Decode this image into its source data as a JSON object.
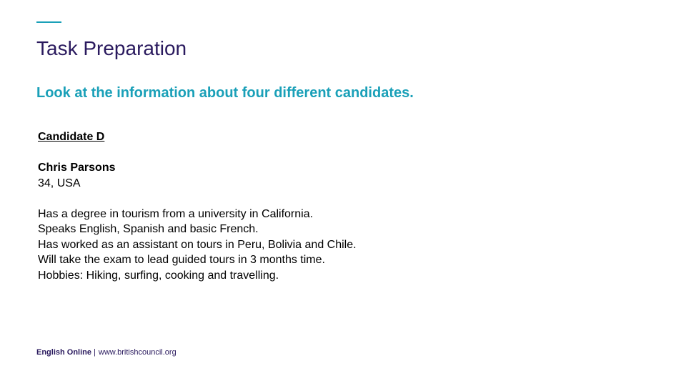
{
  "slide": {
    "title": "Task Preparation",
    "subtitle": "Look at the information about four different candidates."
  },
  "candidate": {
    "heading": "Candidate D",
    "name": "Chris Parsons",
    "age_country": "34, USA",
    "details": [
      "Has a degree in tourism from a university in California.",
      "Speaks English, Spanish and basic French.",
      "Has worked as an assistant on tours in Peru, Bolivia and Chile.",
      "Will take the exam to lead guided tours in 3 months time.",
      "Hobbies: Hiking, surfing, cooking and travelling."
    ]
  },
  "footer": {
    "brand": "English Online",
    "separator": "|",
    "url": "www.britishcouncil.org"
  },
  "colors": {
    "accent": "#1aa0b8",
    "title": "#2a1a5e"
  }
}
